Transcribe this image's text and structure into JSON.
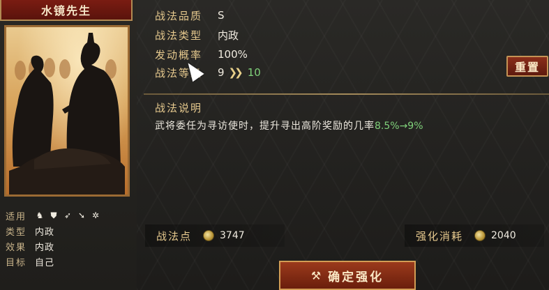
{
  "general": {
    "name": "水镜先生",
    "attributes": [
      {
        "key": "适用",
        "value": ""
      },
      {
        "key": "类型",
        "value": "内政"
      },
      {
        "key": "效果",
        "value": "内政"
      },
      {
        "key": "目标",
        "value": "自己"
      }
    ],
    "unit_icons": [
      "cavalry-icon",
      "shield-icon",
      "bow-icon",
      "spear-icon",
      "wheel-icon"
    ]
  },
  "tactic": {
    "quality_label": "战法品质",
    "quality_value": "S",
    "type_label": "战法类型",
    "type_value": "内政",
    "rate_label": "发动概率",
    "rate_value": "100%",
    "level_label": "战法等级",
    "level_current": "9",
    "level_next": "10",
    "reset_label": "重置",
    "desc_title": "战法说明",
    "desc_text": "武将委任为寻访使时，提升寻出高阶奖励的几率",
    "desc_highlight": "8.5%→9%"
  },
  "resources": {
    "points_label": "战法点",
    "points_value": "3747",
    "cost_label": "强化消耗",
    "cost_value": "2040"
  },
  "actions": {
    "confirm_label": "确定强化"
  },
  "colors": {
    "accent_gold": "#e6c98e",
    "highlight_green": "#7fd07a",
    "button_red": "#8a2e1a"
  }
}
